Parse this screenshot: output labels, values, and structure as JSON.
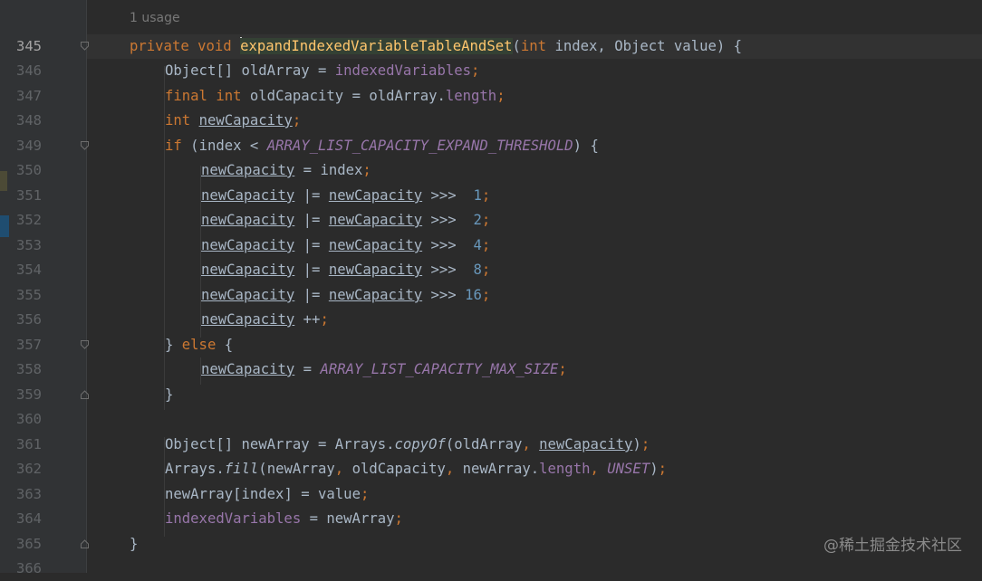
{
  "usage_hint": "1 usage",
  "watermark": "@稀土掘金技术社区",
  "line_numbers": [
    "345",
    "346",
    "347",
    "348",
    "349",
    "350",
    "351",
    "352",
    "353",
    "354",
    "355",
    "356",
    "357",
    "358",
    "359",
    "360",
    "361",
    "362",
    "363",
    "364",
    "365",
    "366"
  ],
  "tokens": {
    "private": "private",
    "void": "void",
    "method_name": "expandIndexedVariableTableAndSet",
    "int": "int",
    "final": "final",
    "if": "if",
    "else": "else",
    "Object": "Object",
    "object_array": "Object[]",
    "Arrays": "Arrays",
    "index": "index",
    "value": "value",
    "oldArray": "oldArray",
    "newArray": "newArray",
    "oldCapacity": "oldCapacity",
    "newCapacity": "newCapacity",
    "indexedVariables": "indexedVariables",
    "length": "length",
    "threshold_const": "ARRAY_LIST_CAPACITY_EXPAND_THRESHOLD",
    "max_const": "ARRAY_LIST_CAPACITY_MAX_SIZE",
    "unset_const": "UNSET",
    "copyOf": "copyOf",
    "fill": "fill",
    "n1": "1",
    "n2": "2",
    "n4": "4",
    "n8": "8",
    "n16": "16"
  }
}
